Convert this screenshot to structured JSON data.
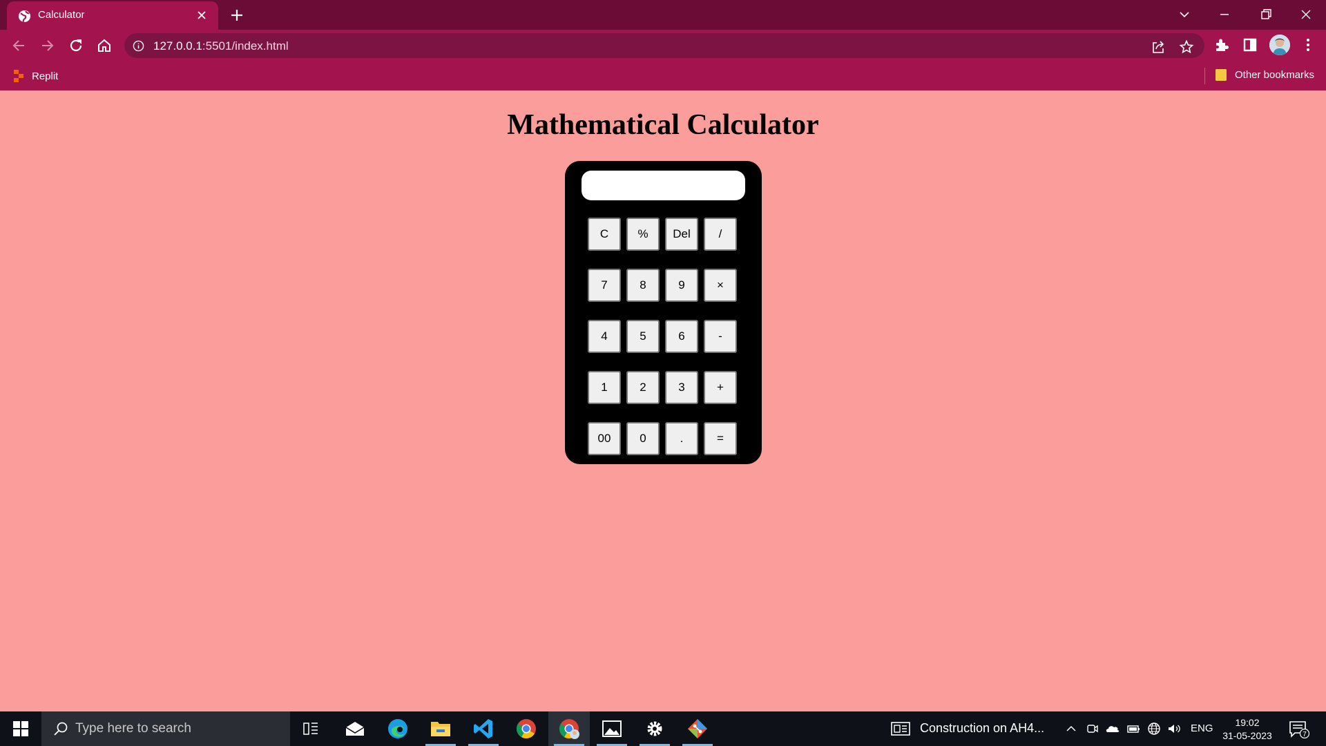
{
  "browser": {
    "tab_title": "Calculator",
    "url_host": "127.0.0.1",
    "url_rest": ":5501/index.html",
    "bookmarks": {
      "replit": "Replit",
      "other": "Other bookmarks"
    }
  },
  "page": {
    "title": "Mathematical Calculator",
    "display_value": "",
    "buttons": [
      [
        "C",
        "%",
        "Del",
        "/"
      ],
      [
        "7",
        "8",
        "9",
        "×"
      ],
      [
        "4",
        "5",
        "6",
        "-"
      ],
      [
        "1",
        "2",
        "3",
        "+"
      ],
      [
        "00",
        "0",
        ".",
        "="
      ]
    ]
  },
  "taskbar": {
    "search_placeholder": "Type here to search",
    "news": "Construction on AH4...",
    "lang": "ENG",
    "time": "19:02",
    "date": "31-05-2023",
    "notification_count": "7"
  },
  "colors": {
    "page_background": "#fb9d9b",
    "browser_frame": "#6b0c36",
    "browser_toolbar": "#a3144f",
    "calculator_body": "#000000"
  },
  "icons": {
    "start": "windows-logo",
    "apps": [
      "task-view",
      "mail",
      "edge",
      "file-explorer",
      "vscode",
      "chrome",
      "chrome-profile",
      "photos",
      "settings",
      "git"
    ]
  }
}
